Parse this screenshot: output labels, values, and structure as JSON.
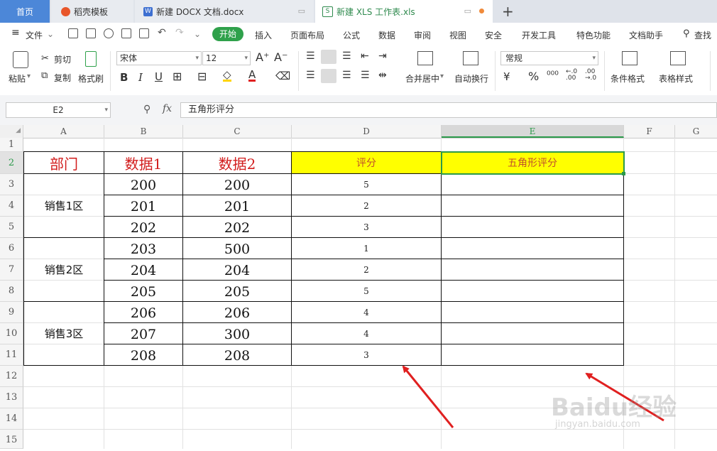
{
  "tabs": {
    "home": "首页",
    "daoke": "稻壳模板",
    "docx": "新建 DOCX 文档.docx",
    "xls": "新建 XLS 工作表.xls",
    "plus": "+"
  },
  "menu": {
    "file": "文件",
    "start": "开始",
    "items": [
      "插入",
      "页面布局",
      "公式",
      "数据",
      "审阅",
      "视图",
      "安全",
      "开发工具",
      "特色功能",
      "文档助手"
    ],
    "search": "查找"
  },
  "ribbon": {
    "paste": "粘贴",
    "cut": "剪切",
    "copy": "复制",
    "format_painter": "格式刷",
    "font_name": "宋体",
    "font_size": "12",
    "merge": "合并居中",
    "wrap": "自动换行",
    "number_format": "常规",
    "cond_format": "条件格式",
    "table_style": "表格样式"
  },
  "formula": {
    "name_box": "E2",
    "fx": "fx",
    "value": "五角形评分"
  },
  "columns": [
    "A",
    "B",
    "C",
    "D",
    "E",
    "F",
    "G"
  ],
  "rows": [
    "1",
    "2",
    "3",
    "4",
    "5",
    "6",
    "7",
    "8",
    "9",
    "10",
    "11",
    "12",
    "13",
    "14",
    "15"
  ],
  "table": {
    "headers": [
      "部门",
      "数据1",
      "数据2",
      "评分",
      "五角形评分"
    ],
    "regions": [
      "销售1区",
      "销售2区",
      "销售3区"
    ],
    "data1": [
      "200",
      "201",
      "202",
      "203",
      "204",
      "205",
      "206",
      "207",
      "208"
    ],
    "data2": [
      "200",
      "201",
      "202",
      "500",
      "204",
      "205",
      "206",
      "300",
      "208"
    ],
    "scores": [
      "5",
      "2",
      "3",
      "1",
      "2",
      "5",
      "4",
      "4",
      "3"
    ]
  },
  "watermark": {
    "brand": "Baidu经验",
    "url": "jingyan.baidu.com"
  },
  "colors": {
    "accent_green": "#2fa14b",
    "header_red": "#d21d1d",
    "highlight_yellow": "#ffff00",
    "arrow_red": "#e02020"
  }
}
